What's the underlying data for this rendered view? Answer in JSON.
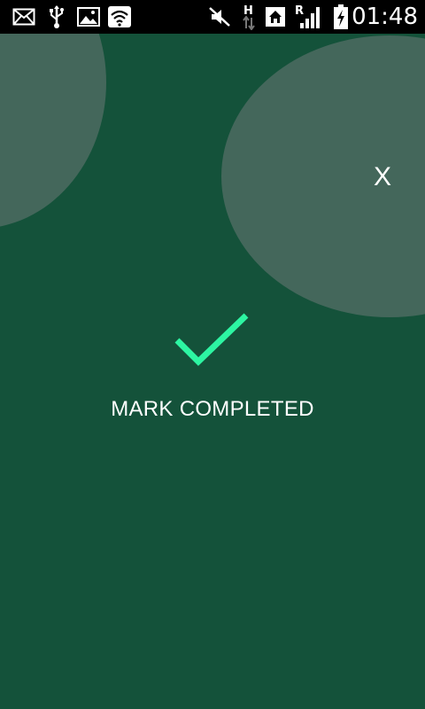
{
  "status_bar": {
    "time": "01:48",
    "icons": [
      "mail-icon",
      "usb-icon",
      "image-icon",
      "wifi-icon",
      "mute-icon",
      "hspa-icon",
      "home-icon",
      "roaming-signal-icon",
      "battery-charging-icon"
    ]
  },
  "dialog": {
    "close_label": "X",
    "message": "MARK COMPLETED",
    "check_icon": "checkmark-icon"
  },
  "colors": {
    "background": "#14523a",
    "bubble": "#44675b",
    "check": "#2df5a2",
    "text": "#ffffff"
  }
}
